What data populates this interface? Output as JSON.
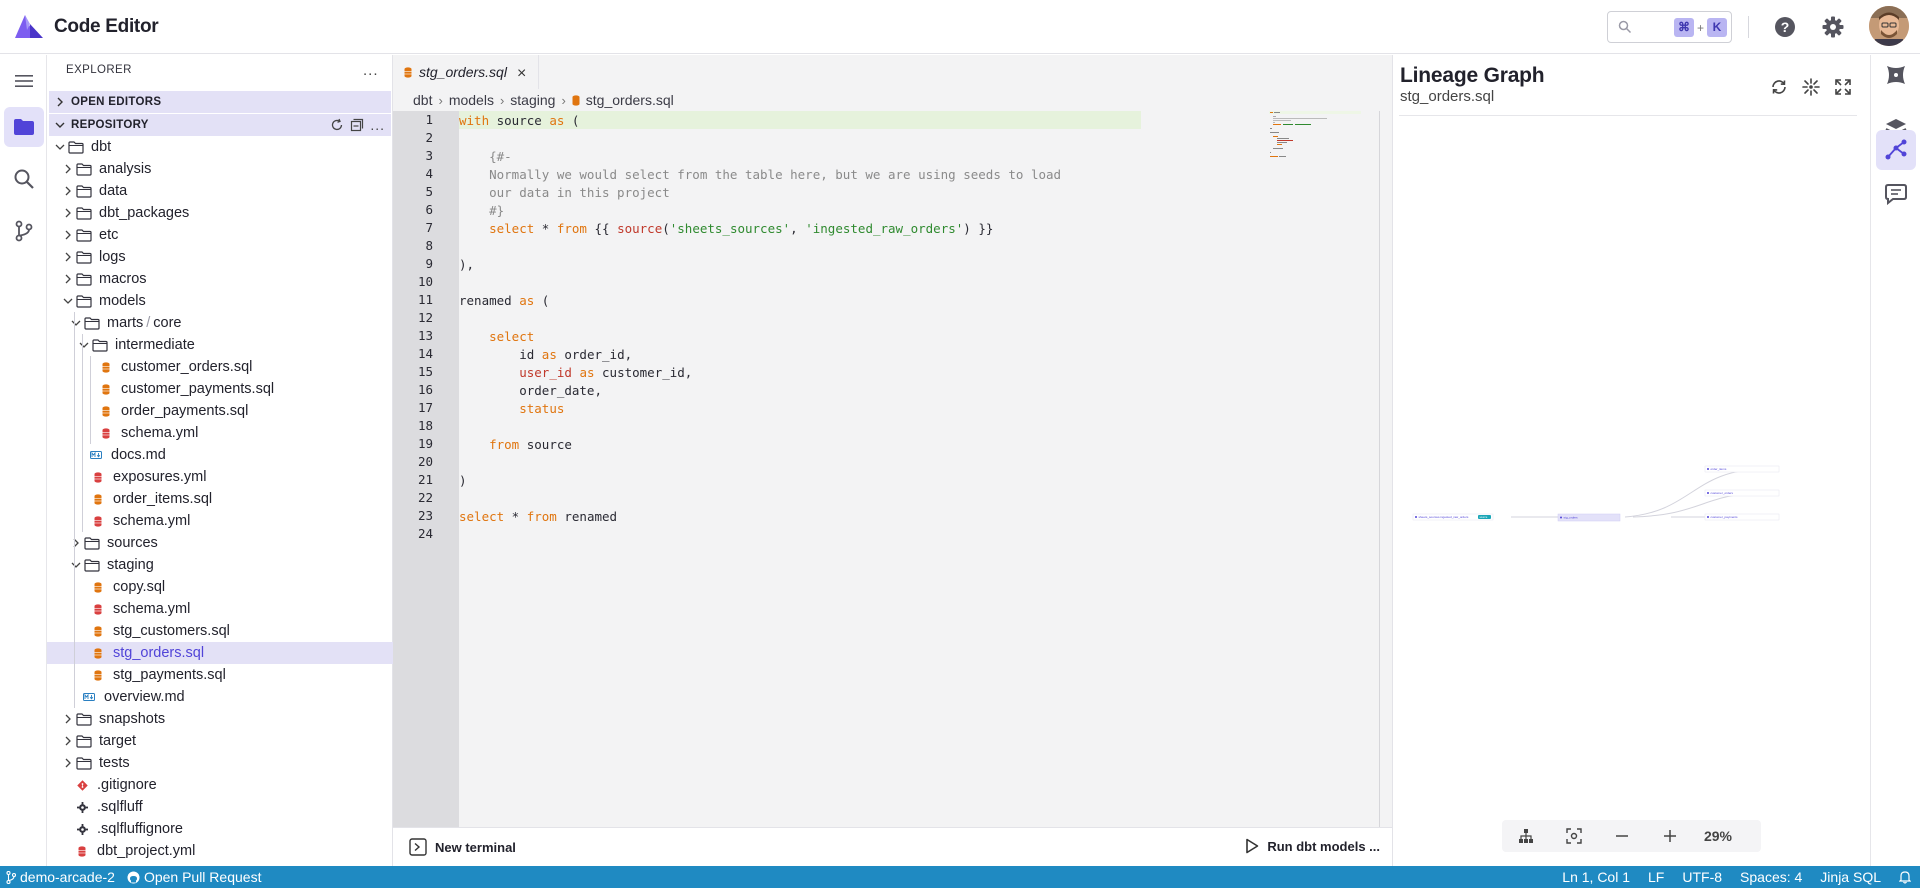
{
  "app": {
    "title": "Code Editor"
  },
  "header": {
    "search_key_cmd": "⌘",
    "search_key_plus": "+",
    "search_key_k": "K"
  },
  "explorer": {
    "title": "EXPLORER",
    "more": "...",
    "open_editors": "OPEN EDITORS",
    "repository": "REPOSITORY",
    "tree": [
      {
        "label": "dbt",
        "kind": "folder",
        "depth": 0,
        "open": true
      },
      {
        "label": "analysis",
        "kind": "folder",
        "depth": 1,
        "open": false
      },
      {
        "label": "data",
        "kind": "folder",
        "depth": 1,
        "open": false
      },
      {
        "label": "dbt_packages",
        "kind": "folder",
        "depth": 1,
        "open": false
      },
      {
        "label": "etc",
        "kind": "folder",
        "depth": 1,
        "open": false
      },
      {
        "label": "logs",
        "kind": "folder",
        "depth": 1,
        "open": false
      },
      {
        "label": "macros",
        "kind": "folder",
        "depth": 1,
        "open": false
      },
      {
        "label": "models",
        "kind": "folder",
        "depth": 1,
        "open": true
      },
      {
        "label": "marts",
        "label2": "core",
        "kind": "folder",
        "depth": 2,
        "open": true
      },
      {
        "label": "intermediate",
        "kind": "folder",
        "depth": 3,
        "open": true
      },
      {
        "label": "customer_orders.sql",
        "kind": "sql",
        "depth": 4
      },
      {
        "label": "customer_payments.sql",
        "kind": "sql",
        "depth": 4
      },
      {
        "label": "order_payments.sql",
        "kind": "sql",
        "depth": 4
      },
      {
        "label": "schema.yml",
        "kind": "yml",
        "depth": 4
      },
      {
        "label": "docs.md",
        "kind": "md",
        "depth": 3
      },
      {
        "label": "exposures.yml",
        "kind": "yml",
        "depth": 3
      },
      {
        "label": "order_items.sql",
        "kind": "sql",
        "depth": 3
      },
      {
        "label": "schema.yml",
        "kind": "yml",
        "depth": 3
      },
      {
        "label": "sources",
        "kind": "folder",
        "depth": 2,
        "open": false
      },
      {
        "label": "staging",
        "kind": "folder",
        "depth": 2,
        "open": true
      },
      {
        "label": "copy.sql",
        "kind": "sql",
        "depth": 3
      },
      {
        "label": "schema.yml",
        "kind": "yml",
        "depth": 3
      },
      {
        "label": "stg_customers.sql",
        "kind": "sql",
        "depth": 3
      },
      {
        "label": "stg_orders.sql",
        "kind": "sql",
        "depth": 3,
        "selected": true
      },
      {
        "label": "stg_payments.sql",
        "kind": "sql",
        "depth": 3
      },
      {
        "label": "overview.md",
        "kind": "md",
        "depth": 2
      },
      {
        "label": "snapshots",
        "kind": "folder",
        "depth": 1,
        "open": false
      },
      {
        "label": "target",
        "kind": "folder",
        "depth": 1,
        "open": false
      },
      {
        "label": "tests",
        "kind": "folder",
        "depth": 1,
        "open": false
      },
      {
        "label": ".gitignore",
        "kind": "git",
        "depth": 1
      },
      {
        "label": ".sqlfluff",
        "kind": "gear",
        "depth": 1
      },
      {
        "label": ".sqlfluffignore",
        "kind": "gear",
        "depth": 1
      },
      {
        "label": "dbt_project.yml",
        "kind": "yml",
        "depth": 1
      }
    ]
  },
  "editor": {
    "tab": {
      "label": "stg_orders.sql",
      "close": "×"
    },
    "breadcrumbs": [
      "dbt",
      "models",
      "staging",
      "stg_orders.sql"
    ],
    "lines": [
      [
        [
          "kw",
          "with"
        ],
        [
          "t",
          " source "
        ],
        [
          "kw",
          "as"
        ],
        [
          "t",
          " ("
        ]
      ],
      [],
      [
        [
          "cm",
          "    {#-"
        ]
      ],
      [
        [
          "cm",
          "    Normally we would select from the table here, but we are using seeds to load"
        ]
      ],
      [
        [
          "cm",
          "    our data in this project"
        ]
      ],
      [
        [
          "cm",
          "    #}"
        ]
      ],
      [
        [
          "t",
          "    "
        ],
        [
          "kw",
          "select"
        ],
        [
          "t",
          " * "
        ],
        [
          "kw",
          "from"
        ],
        [
          "t",
          " {{ "
        ],
        [
          "fn",
          "source"
        ],
        [
          "t",
          "("
        ],
        [
          "str",
          "'sheets_sources'"
        ],
        [
          "t",
          ", "
        ],
        [
          "str",
          "'ingested_raw_orders'"
        ],
        [
          "t",
          ") }}"
        ]
      ],
      [],
      [
        [
          "t",
          "),"
        ]
      ],
      [],
      [
        [
          "t",
          "renamed "
        ],
        [
          "kw",
          "as"
        ],
        [
          "t",
          " ("
        ]
      ],
      [],
      [
        [
          "t",
          "    "
        ],
        [
          "kw",
          "select"
        ]
      ],
      [
        [
          "t",
          "        id "
        ],
        [
          "kw",
          "as"
        ],
        [
          "t",
          " order_id,"
        ]
      ],
      [
        [
          "t",
          "        "
        ],
        [
          "fn",
          "user_id"
        ],
        [
          "t",
          " "
        ],
        [
          "kw",
          "as"
        ],
        [
          "t",
          " customer_id,"
        ]
      ],
      [
        [
          "t",
          "        order_date,"
        ]
      ],
      [
        [
          "t",
          "        "
        ],
        [
          "kw",
          "status"
        ]
      ],
      [],
      [
        [
          "t",
          "    "
        ],
        [
          "kw",
          "from"
        ],
        [
          "t",
          " source"
        ]
      ],
      [],
      [
        [
          "t",
          ")"
        ]
      ],
      [],
      [
        [
          "kw",
          "select"
        ],
        [
          "t",
          " * "
        ],
        [
          "kw",
          "from"
        ],
        [
          "t",
          " renamed"
        ]
      ],
      []
    ],
    "new_terminal": "New terminal",
    "run_models": "Run dbt models ..."
  },
  "lineage": {
    "title": "Lineage Graph",
    "subtitle": "stg_orders.sql",
    "zoom": "29%",
    "nodes": {
      "source": "sheets_sources.ingested_raw_orders",
      "source_badge": "source",
      "stg": "stg_orders",
      "order_items": "order_items",
      "customer_orders": "customer_orders",
      "customer_payments": "customer_payments"
    }
  },
  "status": {
    "branch": "demo-arcade-2",
    "pull_request": "Open Pull Request",
    "cursor": "Ln 1, Col 1",
    "eol": "LF",
    "encoding": "UTF-8",
    "spaces": "Spaces: 4",
    "language": "Jinja SQL"
  },
  "colors": {
    "accent": "#5144d8",
    "status_bar": "#1f8ac2",
    "sql_icon": "#e0750f",
    "yml_icon": "#d94040",
    "md_icon": "#2a7fc1"
  }
}
